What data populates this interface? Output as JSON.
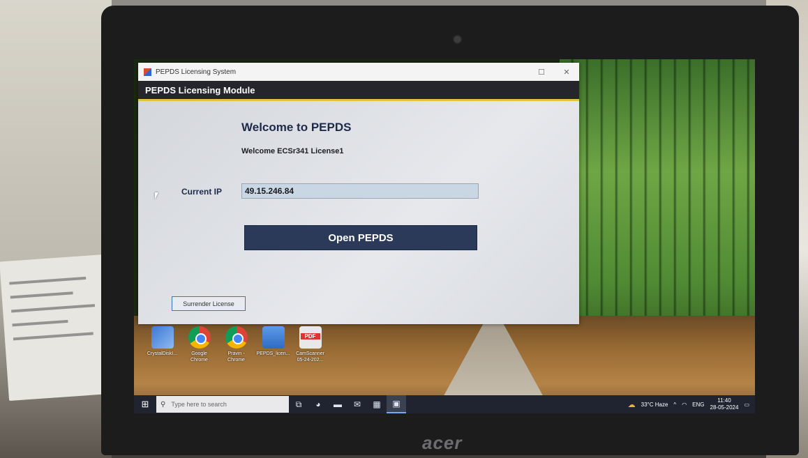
{
  "window": {
    "title": "PEPDS Licensing System",
    "maximize_glyph": "☐",
    "close_glyph": "✕"
  },
  "module": {
    "title": "PEPDS Licensing Module"
  },
  "content": {
    "welcome_title": "Welcome to PEPDS",
    "welcome_user": "Welcome ECSr341  License1",
    "ip_label": "Current IP",
    "ip_value": "49.15.246.84",
    "open_button": "Open PEPDS",
    "surrender_button": "Surrender License"
  },
  "desktop_icons": [
    {
      "label": "CrystalDiskI...",
      "icon": "crystaldisk-icon"
    },
    {
      "label": "Google\nChrome",
      "icon": "chrome-icon"
    },
    {
      "label": "Pravin -\nChrome",
      "icon": "chrome-profile-icon"
    },
    {
      "label": "PEPDS_licen...",
      "icon": "pepds-shortcut-icon"
    },
    {
      "label": "CamScanner\n05-24-202...",
      "icon": "pdf-icon"
    }
  ],
  "taskbar": {
    "start_glyph": "⊞",
    "search_placeholder": "Type here to search",
    "search_glyph": "⚲",
    "pinned": [
      {
        "name": "task-view-icon",
        "glyph": "⧉"
      },
      {
        "name": "edge-icon",
        "glyph": "◕"
      },
      {
        "name": "file-explorer-icon",
        "glyph": "▬"
      },
      {
        "name": "mail-icon",
        "glyph": "✉"
      },
      {
        "name": "store-icon",
        "glyph": "▦"
      },
      {
        "name": "pepds-app-icon",
        "glyph": "▣"
      }
    ],
    "weather_glyph": "☁",
    "weather": "33°C  Haze",
    "tray_chevron": "^",
    "network_glyph": "◠",
    "language": "ENG",
    "time": "11:40",
    "date": "28-05-2024",
    "notification_glyph": "▭"
  },
  "bezel": {
    "brand": "acer"
  }
}
